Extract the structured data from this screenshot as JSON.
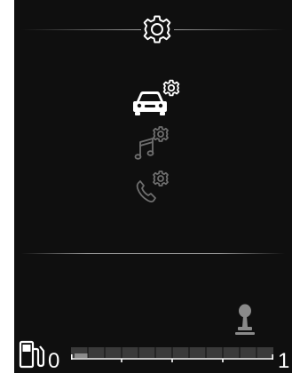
{
  "header": {
    "icon": "gear-icon"
  },
  "menu": {
    "items": [
      {
        "icon": "car-settings-icon",
        "state": "selected"
      },
      {
        "icon": "music-settings-icon",
        "state": "dimmed"
      },
      {
        "icon": "phone-settings-icon",
        "state": "dimmed"
      }
    ]
  },
  "status": {
    "gear_icon": "gear-shift-icon",
    "fuel_icon": "fuel-pump-icon",
    "fuel_scale": {
      "min_label": "0",
      "max_label": "1",
      "level": 0.04
    }
  },
  "colors": {
    "background": "#0f0f0f",
    "selected": "#ffffff",
    "dimmed": "#6e6e6e",
    "divider": "#9a9a9a"
  }
}
